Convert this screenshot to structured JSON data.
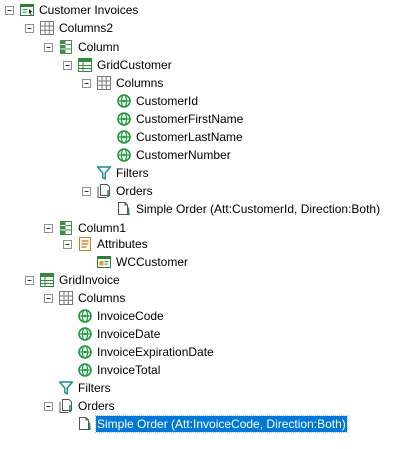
{
  "tree": {
    "nodes": [
      {
        "label": "Customer Invoices",
        "icon": "webform-icon",
        "toggle": "expanded",
        "selected": false
      },
      {
        "label": "Columns2",
        "icon": "table-layout-icon",
        "toggle": "expanded",
        "selected": false
      },
      {
        "label": "Column",
        "icon": "column-icon",
        "toggle": "expanded",
        "selected": false
      },
      {
        "label": "GridCustomer",
        "icon": "grid-icon",
        "toggle": "expanded",
        "selected": false
      },
      {
        "label": "Columns",
        "icon": "table-layout-icon",
        "toggle": "expanded",
        "selected": false
      },
      {
        "label": "CustomerId",
        "icon": "attribute-icon",
        "toggle": "none",
        "selected": false
      },
      {
        "label": "CustomerFirstName",
        "icon": "attribute-icon",
        "toggle": "none",
        "selected": false
      },
      {
        "label": "CustomerLastName",
        "icon": "attribute-icon",
        "toggle": "none",
        "selected": false
      },
      {
        "label": "CustomerNumber",
        "icon": "attribute-icon",
        "toggle": "none",
        "selected": false
      },
      {
        "label": "Filters",
        "icon": "filter-icon",
        "toggle": "none",
        "selected": false
      },
      {
        "label": "Orders",
        "icon": "orders-icon",
        "toggle": "expanded",
        "selected": false
      },
      {
        "label": "Simple Order (Att:CustomerId, Direction:Both)",
        "icon": "simple-order-icon",
        "toggle": "none",
        "selected": false
      },
      {
        "label": "Column1",
        "icon": "column-icon",
        "toggle": "expanded",
        "selected": false
      },
      {
        "label": "Attributes",
        "icon": "attributes-list-icon",
        "toggle": "expanded",
        "selected": false
      },
      {
        "label": "WCCustomer",
        "icon": "web-component-icon",
        "toggle": "none",
        "selected": false
      },
      {
        "label": "GridInvoice",
        "icon": "grid-icon",
        "toggle": "expanded",
        "selected": false
      },
      {
        "label": "Columns",
        "icon": "table-layout-icon",
        "toggle": "expanded",
        "selected": false
      },
      {
        "label": "InvoiceCode",
        "icon": "attribute-icon",
        "toggle": "none",
        "selected": false
      },
      {
        "label": "InvoiceDate",
        "icon": "attribute-icon",
        "toggle": "none",
        "selected": false
      },
      {
        "label": "InvoiceExpirationDate",
        "icon": "attribute-icon",
        "toggle": "none",
        "selected": false
      },
      {
        "label": "InvoiceTotal",
        "icon": "attribute-icon",
        "toggle": "none",
        "selected": false
      },
      {
        "label": "Filters",
        "icon": "filter-icon",
        "toggle": "none",
        "selected": false
      },
      {
        "label": "Orders",
        "icon": "orders-icon",
        "toggle": "expanded",
        "selected": false
      },
      {
        "label": "Simple Order (Att:InvoiceCode, Direction:Both)",
        "icon": "simple-order-icon",
        "toggle": "none",
        "selected": true
      }
    ]
  },
  "colors": {
    "selection": "#0078d7",
    "attribute_green": "#1a9a3c",
    "grid_green": "#2e8b3f",
    "table_gray": "#7a7a7a",
    "filter_teal": "#1a8a8a",
    "attributes_orange": "#d9791a"
  }
}
